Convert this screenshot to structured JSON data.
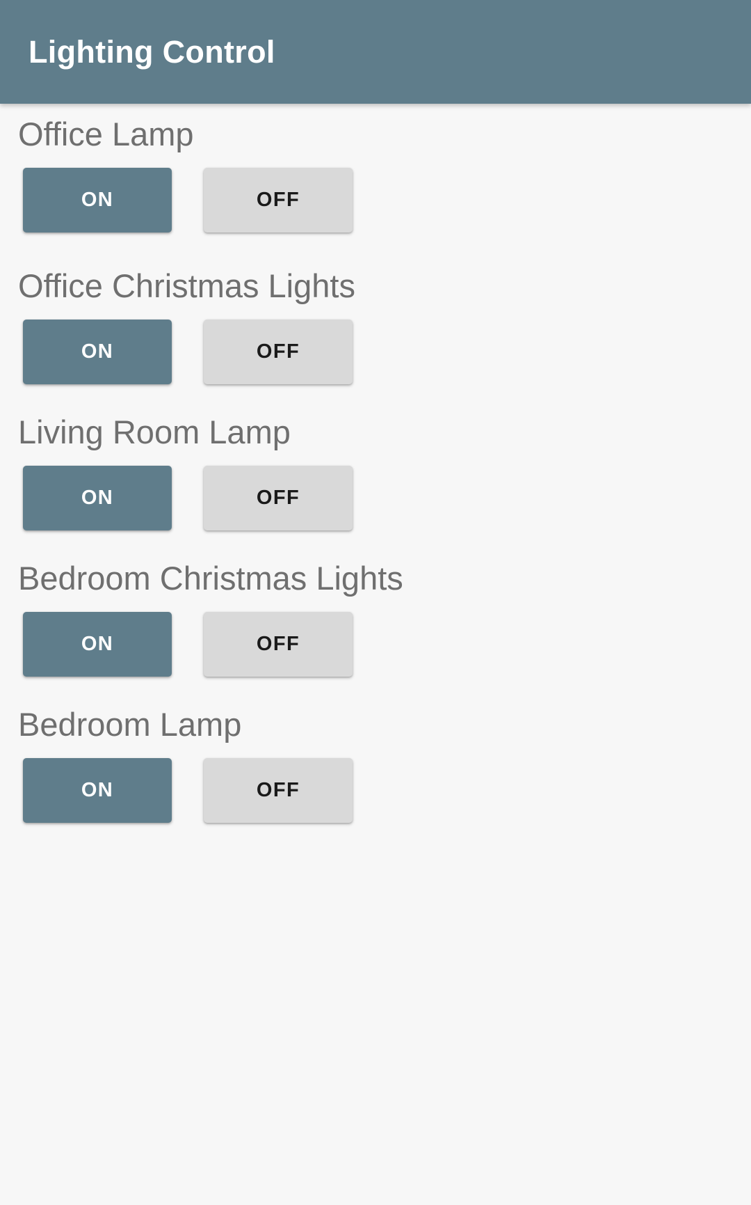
{
  "app": {
    "title": "Lighting Control",
    "header_bg": "#5f7d8b",
    "page_bg": "#f7f7f7",
    "label_color": "#6f6f6f"
  },
  "buttons": {
    "on_label": "ON",
    "off_label": "OFF",
    "on_bg": "#5f7d8b",
    "on_text": "#ffffff",
    "off_bg": "#d9d9d9",
    "off_text": "#1a1a1a"
  },
  "lights": [
    {
      "name": "Office Lamp"
    },
    {
      "name": "Office Christmas Lights"
    },
    {
      "name": "Living Room Lamp"
    },
    {
      "name": "Bedroom Christmas Lights"
    },
    {
      "name": "Bedroom Lamp"
    }
  ]
}
